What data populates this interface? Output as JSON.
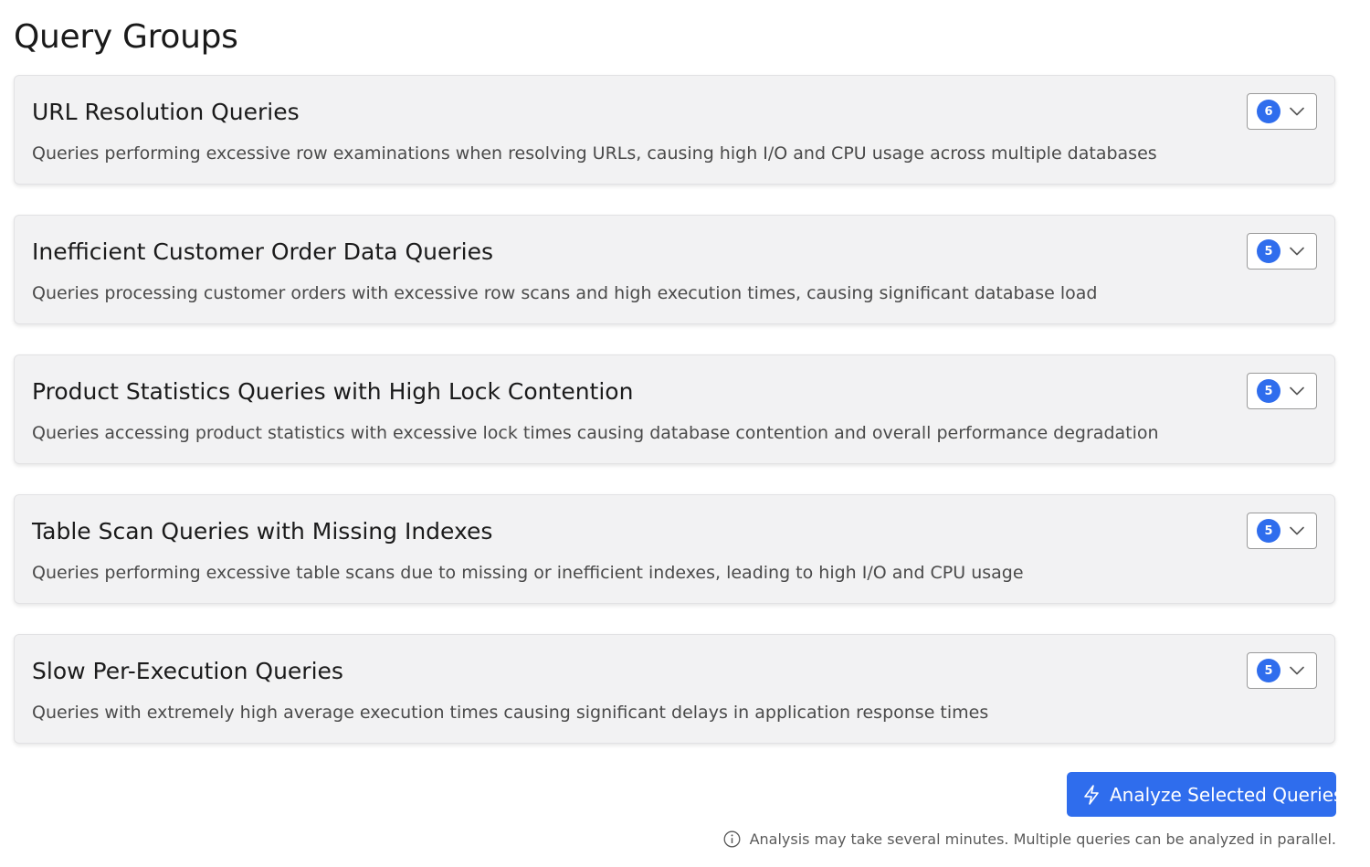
{
  "page": {
    "title": "Query Groups"
  },
  "groups": [
    {
      "title": "URL Resolution Queries",
      "description": "Queries performing excessive row examinations when resolving URLs, causing high I/O and CPU usage across multiple databases",
      "count": "6"
    },
    {
      "title": "Inefficient Customer Order Data Queries",
      "description": "Queries processing customer orders with excessive row scans and high execution times, causing significant database load",
      "count": "5"
    },
    {
      "title": "Product Statistics Queries with High Lock Contention",
      "description": "Queries accessing product statistics with excessive lock times causing database contention and overall performance degradation",
      "count": "5"
    },
    {
      "title": "Table Scan Queries with Missing Indexes",
      "description": "Queries performing excessive table scans due to missing or inefficient indexes, leading to high I/O and CPU usage",
      "count": "5"
    },
    {
      "title": "Slow Per-Execution Queries",
      "description": "Queries with extremely high average execution times causing significant delays in application response times",
      "count": "5"
    }
  ],
  "actions": {
    "analyze_label": "Analyze Selected Queries",
    "analyze_icon": "lightning-bolt-icon"
  },
  "footer": {
    "note": "Analysis may take several minutes. Multiple queries can be analyzed in parallel.",
    "note_icon": "info-icon"
  },
  "colors": {
    "accent": "#2f6ded",
    "card_background": "#f2f2f3"
  }
}
